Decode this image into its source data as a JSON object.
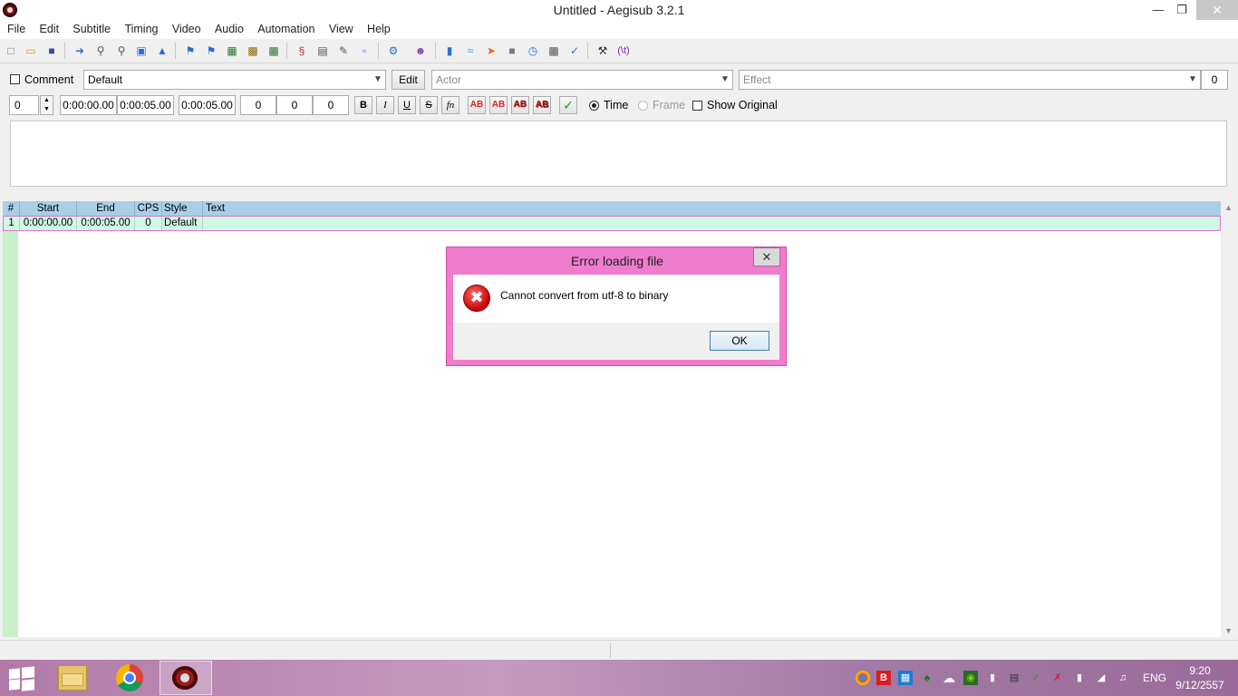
{
  "window": {
    "title": "Untitled - Aegisub 3.2.1"
  },
  "menu": [
    "File",
    "Edit",
    "Subtitle",
    "Timing",
    "Video",
    "Audio",
    "Automation",
    "View",
    "Help"
  ],
  "edit_box": {
    "comment_label": "Comment",
    "style_value": "Default",
    "edit_label": "Edit",
    "actor_placeholder": "Actor",
    "effect_placeholder": "Effect",
    "margin_value": "0",
    "layer_value": "0",
    "start_time": "0:00:00.00",
    "end_time": "0:00:05.00",
    "duration": "0:00:05.00",
    "margin_left": "0",
    "margin_right": "0",
    "margin_vert": "0",
    "bold": "B",
    "italic": "I",
    "underline": "U",
    "strike": "S",
    "font": "fn",
    "color1": "AB",
    "color2": "AB",
    "color3": "AB",
    "color4": "AB",
    "time_label": "Time",
    "frame_label": "Frame",
    "show_original_label": "Show Original"
  },
  "grid": {
    "headers": [
      "#",
      "Start",
      "End",
      "CPS",
      "Style",
      "Text"
    ],
    "rows": [
      {
        "num": "1",
        "start": "0:00:00.00",
        "end": "0:00:05.00",
        "cps": "0",
        "style": "Default",
        "text": ""
      }
    ]
  },
  "dialog": {
    "title": "Error loading file",
    "message": "Cannot convert from utf-8 to binary",
    "ok_label": "OK"
  },
  "taskbar": {
    "lang": "ENG",
    "time": "9:20",
    "date": "9/12/2557"
  },
  "colors": {
    "dialog_frame": "#ef7ccd",
    "grid_header": "#a8cfe6",
    "grid_row": "#cdf9e2",
    "taskbar": "#b07aa8"
  }
}
